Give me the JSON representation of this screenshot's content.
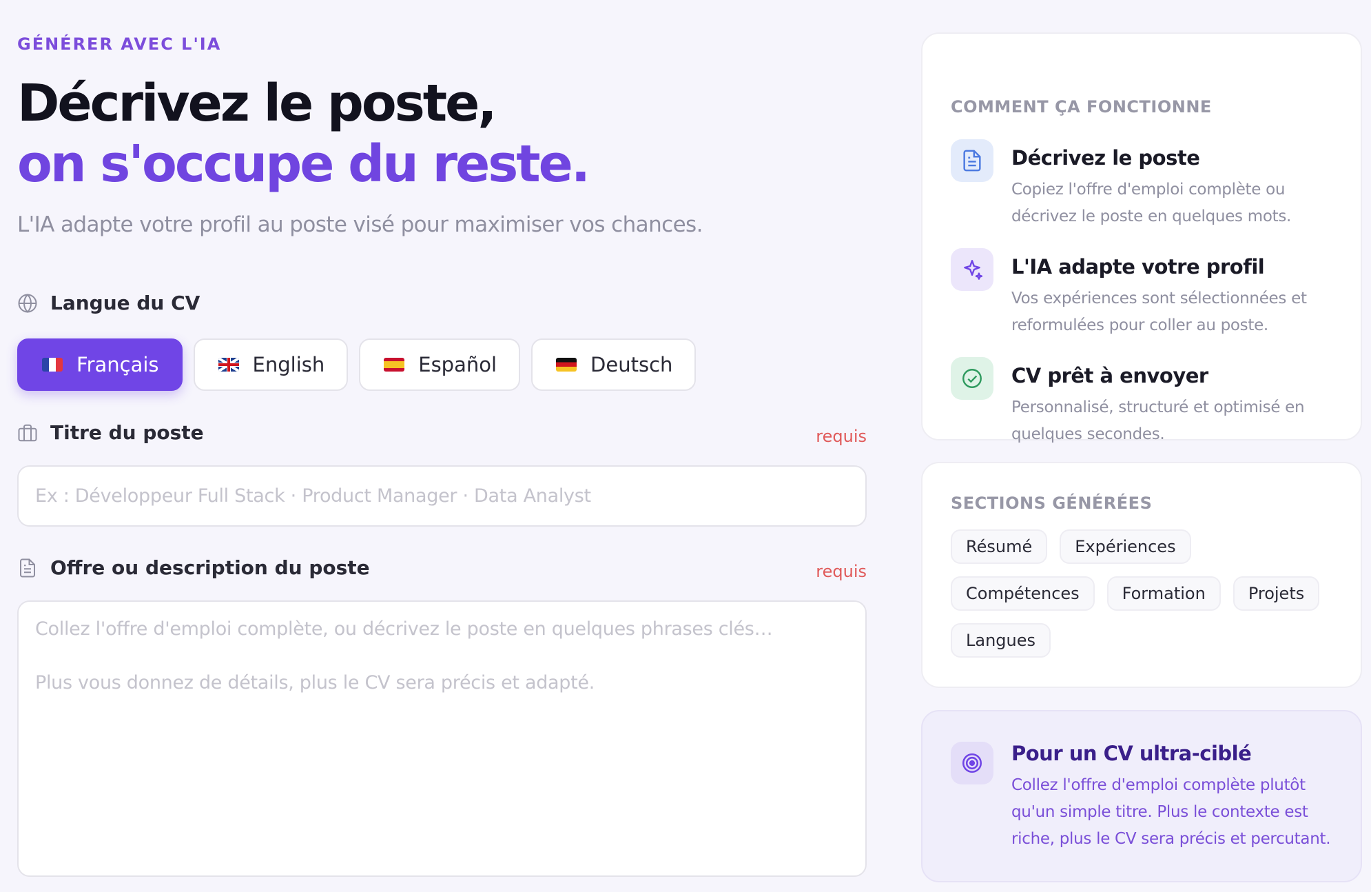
{
  "header": {
    "eyebrow": "GÉNÉRER AVEC L'IA",
    "title_line1": "Décrivez le poste,",
    "title_line2": "on s'occupe du reste.",
    "subtitle": "L'IA adapte votre profil au poste visé pour maximiser vos chances."
  },
  "language": {
    "label": "Langue du CV",
    "options": [
      {
        "label": "Français",
        "flag": "fr",
        "selected": true
      },
      {
        "label": "English",
        "flag": "gb",
        "selected": false
      },
      {
        "label": "Español",
        "flag": "es",
        "selected": false
      },
      {
        "label": "Deutsch",
        "flag": "de",
        "selected": false
      }
    ]
  },
  "job_title": {
    "label": "Titre du poste",
    "required_label": "requis",
    "value": "",
    "placeholder": "Ex : Développeur Full Stack · Product Manager · Data Analyst"
  },
  "job_description": {
    "label": "Offre ou description du poste",
    "required_label": "requis",
    "value": "",
    "placeholder_line1": "Collez l'offre d'emploi complète, ou décrivez le poste en quelques phrases clés…",
    "placeholder_line2": "Plus vous donnez de détails, plus le CV sera précis et adapté."
  },
  "how_it_works": {
    "title": "COMMENT ÇA FONCTIONNE",
    "steps": [
      {
        "title": "Décrivez le poste",
        "desc": "Copiez l'offre d'emploi complète ou décrivez le poste en quelques mots.",
        "icon": "document-icon"
      },
      {
        "title": "L'IA adapte votre profil",
        "desc": "Vos expériences sont sélectionnées et reformulées pour coller au poste.",
        "icon": "sparkle-icon"
      },
      {
        "title": "CV prêt à envoyer",
        "desc": "Personnalisé, structuré et optimisé en quelques secondes.",
        "icon": "check-circle-icon"
      }
    ]
  },
  "generated_sections": {
    "title": "SECTIONS GÉNÉRÉES",
    "chips": [
      "Résumé",
      "Expériences",
      "Compétences",
      "Formation",
      "Projets",
      "Langues"
    ]
  },
  "tip": {
    "title": "Pour un CV ultra-ciblé",
    "desc": "Collez l'offre d'emploi complète plutôt qu'un simple titre. Plus le contexte est riche, plus le CV sera précis et percutant.",
    "icon": "target-icon"
  },
  "colors": {
    "accent": "#7045e6",
    "required": "#e05a5a",
    "muted": "#8f8fa0"
  }
}
